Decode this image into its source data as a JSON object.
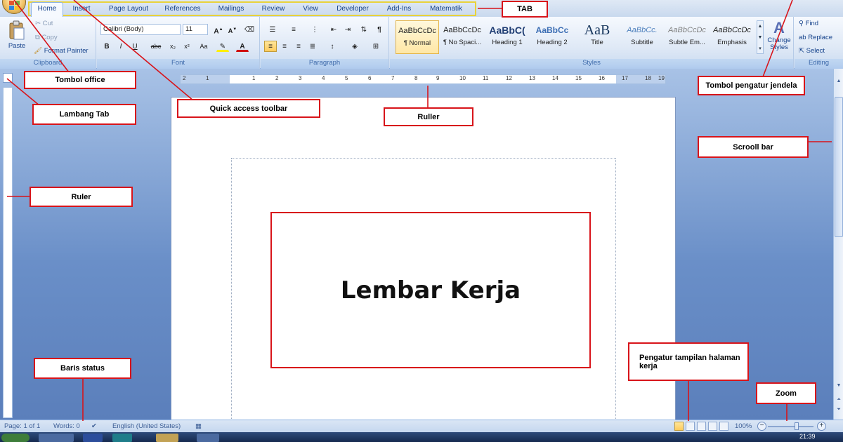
{
  "tabs": [
    "Home",
    "Insert",
    "Page Layout",
    "References",
    "Mailings",
    "Review",
    "View",
    "Developer",
    "Add-Ins",
    "Matematik"
  ],
  "active_tab": "Home",
  "ribbon": {
    "clipboard": {
      "paste": "Paste",
      "cut": "Cut",
      "copy": "Copy",
      "format_painter": "Format Painter",
      "label": "Clipboard"
    },
    "font": {
      "font_name": "Calibri (Body)",
      "font_size": "11",
      "label": "Font"
    },
    "paragraph": {
      "label": "Paragraph"
    },
    "styles": {
      "items": [
        {
          "sample": "AaBbCcDc",
          "name": "¶ Normal"
        },
        {
          "sample": "AaBbCcDc",
          "name": "¶ No Spaci..."
        },
        {
          "sample": "AaBbC(",
          "name": "Heading 1"
        },
        {
          "sample": "AaBbCc",
          "name": "Heading 2"
        },
        {
          "sample": "AaB",
          "name": "Title"
        },
        {
          "sample": "AaBbCc.",
          "name": "Subtitle"
        },
        {
          "sample": "AaBbCcDc",
          "name": "Subtle Em..."
        },
        {
          "sample": "AaBbCcDc",
          "name": "Emphasis"
        }
      ],
      "change_styles": "Change Styles",
      "label": "Styles"
    },
    "editing": {
      "find": "Find",
      "replace": "Replace",
      "select": "Select",
      "label": "Editing"
    }
  },
  "ruler_numbers": [
    "2",
    "1",
    "1",
    "2",
    "3",
    "4",
    "5",
    "6",
    "7",
    "8",
    "9",
    "10",
    "11",
    "12",
    "13",
    "14",
    "15",
    "16",
    "17",
    "18",
    "19"
  ],
  "status": {
    "page": "Page: 1 of 1",
    "words": "Words: 0",
    "language": "English (United States)",
    "zoom": "100%"
  },
  "annotations": {
    "tombol_office": "Tombol office",
    "quick_access": "Quick access toolbar",
    "tab": "TAB",
    "tombol_pengatur": "Tombol pengatur jendela",
    "lambang_tab": "Lambang Tab",
    "ruller": "Ruller",
    "scrooll_bar": "Scrooll bar",
    "ruler": "Ruler",
    "lembar_kerja": "Lembar Kerja",
    "baris_status": "Baris status",
    "pengatur_tampilan": "Pengatur tampilan halaman kerja",
    "zoom": "Zoom"
  },
  "taskbar_clock": "21:39",
  "colors": {
    "annotation_red": "#d8141a",
    "tab_highlight": "#e8d23a",
    "ribbon_text": "#15428b"
  }
}
